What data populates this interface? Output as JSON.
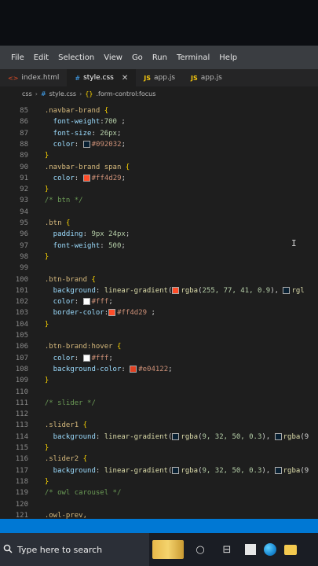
{
  "menu": [
    "File",
    "Edit",
    "Selection",
    "View",
    "Go",
    "Run",
    "Terminal",
    "Help"
  ],
  "tabs": [
    {
      "icon": "<>",
      "label": "index.html",
      "kind": "html"
    },
    {
      "icon": "#",
      "label": "style.css",
      "kind": "css"
    },
    {
      "icon": "JS",
      "label": "app.js",
      "kind": "js"
    },
    {
      "icon": "JS",
      "label": "app.js",
      "kind": "js"
    }
  ],
  "breadcrumb": {
    "folder": "css",
    "file": "style.css",
    "symbol": ".form-control:focus"
  },
  "lines": [
    {
      "n": "85",
      "parts": [
        [
          "sel",
          "  .navbar-brand "
        ],
        [
          "brc",
          "{"
        ]
      ]
    },
    {
      "n": "86",
      "parts": [
        [
          "prop",
          "    font-weight"
        ],
        [
          "code",
          ":"
        ],
        [
          "num",
          "700"
        ],
        [
          "code",
          " ;"
        ]
      ]
    },
    {
      "n": "87",
      "parts": [
        [
          "prop",
          "    font-size"
        ],
        [
          "code",
          ": "
        ],
        [
          "num",
          "26px"
        ],
        [
          "code",
          ";"
        ]
      ]
    },
    {
      "n": "88",
      "parts": [
        [
          "prop",
          "    color"
        ],
        [
          "code",
          ": "
        ],
        [
          "swatch",
          "#092032"
        ],
        [
          "val",
          "#092032"
        ],
        [
          "code",
          ";"
        ]
      ]
    },
    {
      "n": "89",
      "parts": [
        [
          "brc",
          "  }"
        ]
      ]
    },
    {
      "n": "90",
      "parts": [
        [
          "sel",
          "  .navbar-brand span "
        ],
        [
          "brc",
          "{"
        ]
      ]
    },
    {
      "n": "91",
      "parts": [
        [
          "prop",
          "    color"
        ],
        [
          "code",
          ": "
        ],
        [
          "swatch",
          "#ff4d29"
        ],
        [
          "val",
          "#ff4d29"
        ],
        [
          "code",
          ";"
        ]
      ]
    },
    {
      "n": "92",
      "parts": [
        [
          "brc",
          "  }"
        ]
      ]
    },
    {
      "n": "93",
      "parts": [
        [
          "com",
          "  /* btn */"
        ]
      ]
    },
    {
      "n": "94",
      "parts": []
    },
    {
      "n": "95",
      "parts": [
        [
          "sel",
          "  .btn "
        ],
        [
          "brc",
          "{"
        ]
      ]
    },
    {
      "n": "96",
      "parts": [
        [
          "prop",
          "    padding"
        ],
        [
          "code",
          ": "
        ],
        [
          "num",
          "9px 24px"
        ],
        [
          "code",
          ";"
        ]
      ]
    },
    {
      "n": "97",
      "parts": [
        [
          "prop",
          "    font-weight"
        ],
        [
          "code",
          ": "
        ],
        [
          "num",
          "500"
        ],
        [
          "code",
          ";"
        ]
      ]
    },
    {
      "n": "98",
      "parts": [
        [
          "brc",
          "  }"
        ]
      ]
    },
    {
      "n": "99",
      "parts": []
    },
    {
      "n": "100",
      "parts": [
        [
          "sel",
          "  .btn-brand "
        ],
        [
          "brc",
          "{"
        ]
      ]
    },
    {
      "n": "101",
      "parts": [
        [
          "prop",
          "    background"
        ],
        [
          "code",
          ": "
        ],
        [
          "fn",
          "linear-gradient"
        ],
        [
          "code",
          "("
        ],
        [
          "swatch",
          "#ff4d29"
        ],
        [
          "fn",
          "rgba"
        ],
        [
          "code",
          "("
        ],
        [
          "num",
          "255, 77, 41, 0.9"
        ],
        [
          "code",
          "), "
        ],
        [
          "swatch",
          "#092032"
        ],
        [
          "fn",
          "rgl"
        ]
      ]
    },
    {
      "n": "102",
      "parts": [
        [
          "prop",
          "    color"
        ],
        [
          "code",
          ": "
        ],
        [
          "swatch",
          "#ffffff"
        ],
        [
          "val",
          "#fff"
        ],
        [
          "code",
          ";"
        ]
      ]
    },
    {
      "n": "103",
      "parts": [
        [
          "prop",
          "    border-color"
        ],
        [
          "code",
          ":"
        ],
        [
          "swatch",
          "#ff4d29"
        ],
        [
          "val",
          "#ff4d29"
        ],
        [
          "code",
          " ;"
        ]
      ]
    },
    {
      "n": "104",
      "parts": [
        [
          "brc",
          "  }"
        ]
      ]
    },
    {
      "n": "105",
      "parts": []
    },
    {
      "n": "106",
      "parts": [
        [
          "sel",
          "  .btn-brand:hover "
        ],
        [
          "brc",
          "{"
        ]
      ]
    },
    {
      "n": "107",
      "parts": [
        [
          "prop",
          "    color"
        ],
        [
          "code",
          ": "
        ],
        [
          "swatch",
          "#ffffff"
        ],
        [
          "val",
          "#fff"
        ],
        [
          "code",
          ";"
        ]
      ]
    },
    {
      "n": "108",
      "parts": [
        [
          "prop",
          "    background-color"
        ],
        [
          "code",
          ": "
        ],
        [
          "swatch",
          "#e04122"
        ],
        [
          "val",
          "#e04122"
        ],
        [
          "code",
          ";"
        ]
      ]
    },
    {
      "n": "109",
      "parts": [
        [
          "brc",
          "  }"
        ]
      ]
    },
    {
      "n": "110",
      "parts": []
    },
    {
      "n": "111",
      "parts": [
        [
          "com",
          "  /* slider */"
        ]
      ]
    },
    {
      "n": "112",
      "parts": []
    },
    {
      "n": "113",
      "parts": [
        [
          "sel",
          "  .slider1 "
        ],
        [
          "brc",
          "{"
        ]
      ]
    },
    {
      "n": "114",
      "parts": [
        [
          "prop",
          "    background"
        ],
        [
          "code",
          ": "
        ],
        [
          "fn",
          "linear-gradient"
        ],
        [
          "code",
          "("
        ],
        [
          "swatch",
          "#092032"
        ],
        [
          "fn",
          "rgba"
        ],
        [
          "code",
          "("
        ],
        [
          "num",
          "9, 32, 50, 0.3"
        ],
        [
          "code",
          "), "
        ],
        [
          "swatch",
          "#092032"
        ],
        [
          "fn",
          "rgba"
        ],
        [
          "code",
          "(9"
        ]
      ]
    },
    {
      "n": "115",
      "parts": [
        [
          "brc",
          "  }"
        ]
      ]
    },
    {
      "n": "116",
      "parts": [
        [
          "sel",
          "  .slider2 "
        ],
        [
          "brc",
          "{"
        ]
      ]
    },
    {
      "n": "117",
      "parts": [
        [
          "prop",
          "    background"
        ],
        [
          "code",
          ": "
        ],
        [
          "fn",
          "linear-gradient"
        ],
        [
          "code",
          "("
        ],
        [
          "swatch",
          "#092032"
        ],
        [
          "fn",
          "rgba"
        ],
        [
          "code",
          "("
        ],
        [
          "num",
          "9, 32, 50, 0.3"
        ],
        [
          "code",
          "), "
        ],
        [
          "swatch",
          "#092032"
        ],
        [
          "fn",
          "rgba"
        ],
        [
          "code",
          "(9"
        ]
      ]
    },
    {
      "n": "118",
      "parts": [
        [
          "brc",
          "  }"
        ]
      ]
    },
    {
      "n": "119",
      "parts": [
        [
          "com",
          "  /* owl carousel */"
        ]
      ]
    },
    {
      "n": "120",
      "parts": []
    },
    {
      "n": "121",
      "parts": [
        [
          "sel",
          "  .owl-prev,"
        ]
      ]
    }
  ],
  "taskbar": {
    "search_placeholder": "Type here to search"
  }
}
